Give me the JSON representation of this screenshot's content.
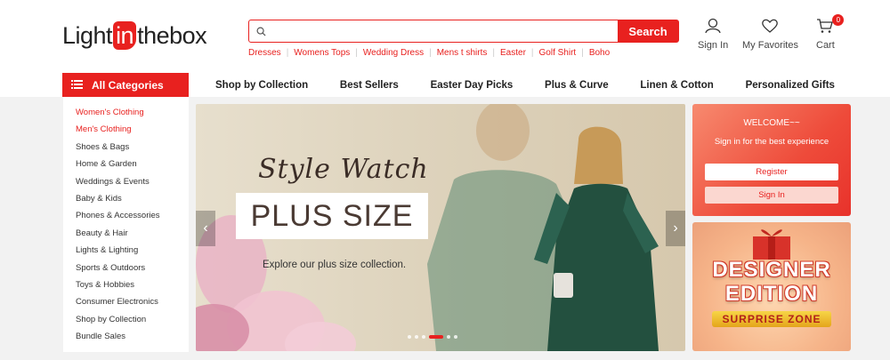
{
  "logo": {
    "part1": "Light",
    "part2": "in",
    "part3": "thebox"
  },
  "search": {
    "placeholder": "",
    "button": "Search"
  },
  "hot_searches": [
    "Dresses",
    "Womens Tops",
    "Wedding Dress",
    "Mens t shirts",
    "Easter",
    "Golf Shirt",
    "Boho"
  ],
  "header_icons": {
    "signin": "Sign In",
    "favorites": "My Favorites",
    "cart": "Cart",
    "cart_count": "0"
  },
  "nav": {
    "all_categories": "All Categories",
    "links": [
      "Shop by Collection",
      "Best Sellers",
      "Easter Day Picks",
      "Plus & Curve",
      "Linen & Cotton",
      "Personalized Gifts"
    ]
  },
  "sidebar": {
    "items": [
      "Women's Clothing",
      "Men's Clothing",
      "Shoes & Bags",
      "Home & Garden",
      "Weddings & Events",
      "Baby & Kids",
      "Phones & Accessories",
      "Beauty & Hair",
      "Lights & Lighting",
      "Sports & Outdoors",
      "Toys & Hobbies",
      "Consumer Electronics",
      "Shop by Collection",
      "Bundle Sales"
    ]
  },
  "banner": {
    "script_title": "Style Watch",
    "headline": "PLUS SIZE",
    "subtext": "Explore our plus size collection.",
    "dress_color": "#23503f"
  },
  "welcome": {
    "title": "WELCOME~~",
    "message": "Sign in for the best experience",
    "register": "Register",
    "signin": "Sign In"
  },
  "promo": {
    "line1": "DESIGNER",
    "line2": "EDITION",
    "zone": "SURPRISE ZONE"
  },
  "colors": {
    "brand": "#e8211f"
  }
}
